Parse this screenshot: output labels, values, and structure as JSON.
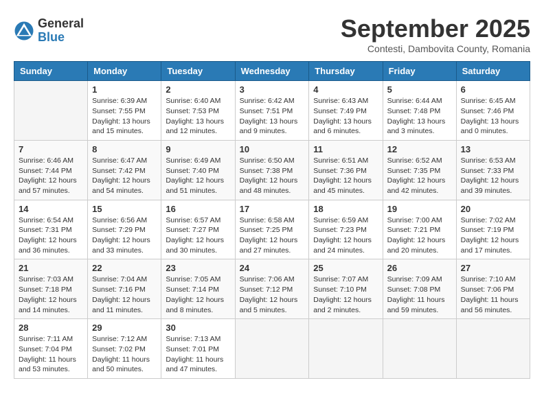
{
  "header": {
    "logo": {
      "general": "General",
      "blue": "Blue"
    },
    "title": "September 2025",
    "subtitle": "Contesti, Dambovita County, Romania"
  },
  "weekdays": [
    "Sunday",
    "Monday",
    "Tuesday",
    "Wednesday",
    "Thursday",
    "Friday",
    "Saturday"
  ],
  "weeks": [
    [
      {
        "day": "",
        "info": ""
      },
      {
        "day": "1",
        "info": "Sunrise: 6:39 AM\nSunset: 7:55 PM\nDaylight: 13 hours\nand 15 minutes."
      },
      {
        "day": "2",
        "info": "Sunrise: 6:40 AM\nSunset: 7:53 PM\nDaylight: 13 hours\nand 12 minutes."
      },
      {
        "day": "3",
        "info": "Sunrise: 6:42 AM\nSunset: 7:51 PM\nDaylight: 13 hours\nand 9 minutes."
      },
      {
        "day": "4",
        "info": "Sunrise: 6:43 AM\nSunset: 7:49 PM\nDaylight: 13 hours\nand 6 minutes."
      },
      {
        "day": "5",
        "info": "Sunrise: 6:44 AM\nSunset: 7:48 PM\nDaylight: 13 hours\nand 3 minutes."
      },
      {
        "day": "6",
        "info": "Sunrise: 6:45 AM\nSunset: 7:46 PM\nDaylight: 13 hours\nand 0 minutes."
      }
    ],
    [
      {
        "day": "7",
        "info": "Sunrise: 6:46 AM\nSunset: 7:44 PM\nDaylight: 12 hours\nand 57 minutes."
      },
      {
        "day": "8",
        "info": "Sunrise: 6:47 AM\nSunset: 7:42 PM\nDaylight: 12 hours\nand 54 minutes."
      },
      {
        "day": "9",
        "info": "Sunrise: 6:49 AM\nSunset: 7:40 PM\nDaylight: 12 hours\nand 51 minutes."
      },
      {
        "day": "10",
        "info": "Sunrise: 6:50 AM\nSunset: 7:38 PM\nDaylight: 12 hours\nand 48 minutes."
      },
      {
        "day": "11",
        "info": "Sunrise: 6:51 AM\nSunset: 7:36 PM\nDaylight: 12 hours\nand 45 minutes."
      },
      {
        "day": "12",
        "info": "Sunrise: 6:52 AM\nSunset: 7:35 PM\nDaylight: 12 hours\nand 42 minutes."
      },
      {
        "day": "13",
        "info": "Sunrise: 6:53 AM\nSunset: 7:33 PM\nDaylight: 12 hours\nand 39 minutes."
      }
    ],
    [
      {
        "day": "14",
        "info": "Sunrise: 6:54 AM\nSunset: 7:31 PM\nDaylight: 12 hours\nand 36 minutes."
      },
      {
        "day": "15",
        "info": "Sunrise: 6:56 AM\nSunset: 7:29 PM\nDaylight: 12 hours\nand 33 minutes."
      },
      {
        "day": "16",
        "info": "Sunrise: 6:57 AM\nSunset: 7:27 PM\nDaylight: 12 hours\nand 30 minutes."
      },
      {
        "day": "17",
        "info": "Sunrise: 6:58 AM\nSunset: 7:25 PM\nDaylight: 12 hours\nand 27 minutes."
      },
      {
        "day": "18",
        "info": "Sunrise: 6:59 AM\nSunset: 7:23 PM\nDaylight: 12 hours\nand 24 minutes."
      },
      {
        "day": "19",
        "info": "Sunrise: 7:00 AM\nSunset: 7:21 PM\nDaylight: 12 hours\nand 20 minutes."
      },
      {
        "day": "20",
        "info": "Sunrise: 7:02 AM\nSunset: 7:19 PM\nDaylight: 12 hours\nand 17 minutes."
      }
    ],
    [
      {
        "day": "21",
        "info": "Sunrise: 7:03 AM\nSunset: 7:18 PM\nDaylight: 12 hours\nand 14 minutes."
      },
      {
        "day": "22",
        "info": "Sunrise: 7:04 AM\nSunset: 7:16 PM\nDaylight: 12 hours\nand 11 minutes."
      },
      {
        "day": "23",
        "info": "Sunrise: 7:05 AM\nSunset: 7:14 PM\nDaylight: 12 hours\nand 8 minutes."
      },
      {
        "day": "24",
        "info": "Sunrise: 7:06 AM\nSunset: 7:12 PM\nDaylight: 12 hours\nand 5 minutes."
      },
      {
        "day": "25",
        "info": "Sunrise: 7:07 AM\nSunset: 7:10 PM\nDaylight: 12 hours\nand 2 minutes."
      },
      {
        "day": "26",
        "info": "Sunrise: 7:09 AM\nSunset: 7:08 PM\nDaylight: 11 hours\nand 59 minutes."
      },
      {
        "day": "27",
        "info": "Sunrise: 7:10 AM\nSunset: 7:06 PM\nDaylight: 11 hours\nand 56 minutes."
      }
    ],
    [
      {
        "day": "28",
        "info": "Sunrise: 7:11 AM\nSunset: 7:04 PM\nDaylight: 11 hours\nand 53 minutes."
      },
      {
        "day": "29",
        "info": "Sunrise: 7:12 AM\nSunset: 7:02 PM\nDaylight: 11 hours\nand 50 minutes."
      },
      {
        "day": "30",
        "info": "Sunrise: 7:13 AM\nSunset: 7:01 PM\nDaylight: 11 hours\nand 47 minutes."
      },
      {
        "day": "",
        "info": ""
      },
      {
        "day": "",
        "info": ""
      },
      {
        "day": "",
        "info": ""
      },
      {
        "day": "",
        "info": ""
      }
    ]
  ]
}
